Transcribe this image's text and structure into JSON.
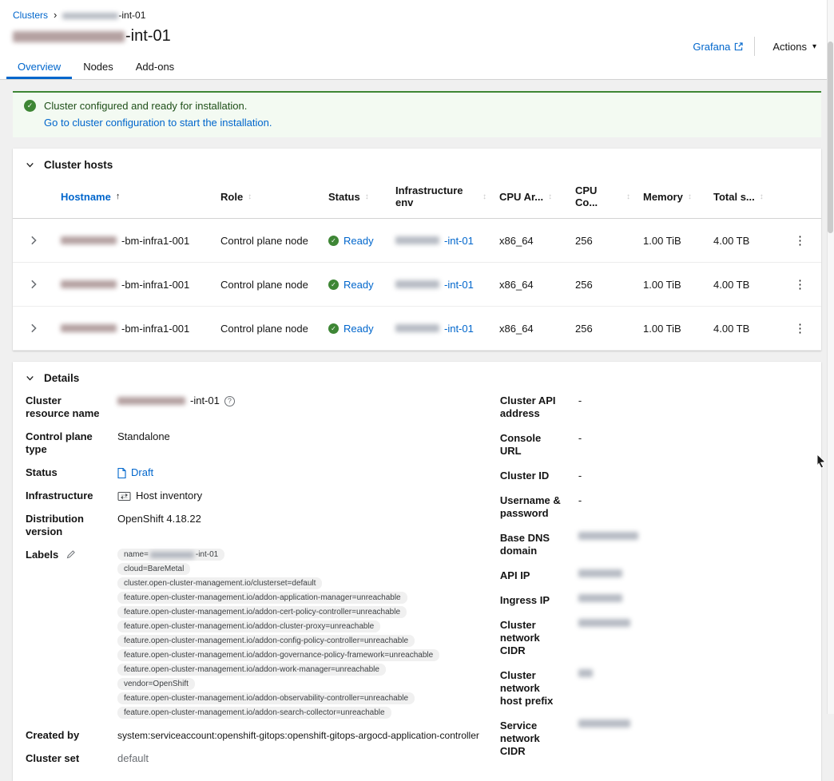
{
  "colors": {
    "accent": "#0066cc",
    "success": "#3e8635"
  },
  "icons": {
    "breadcrumb_separator": "›",
    "caret_down": "▾",
    "kebab": "⋮",
    "sort_asc": "↑",
    "sort_none": "↕",
    "check": "✓",
    "help": "?"
  },
  "breadcrumb": {
    "root": "Clusters",
    "current_suffix": "-int-01"
  },
  "title_suffix": "-int-01",
  "header_actions": {
    "grafana": "Grafana",
    "actions": "Actions"
  },
  "tabs": [
    {
      "label": "Overview",
      "active": true
    },
    {
      "label": "Nodes",
      "active": false
    },
    {
      "label": "Add-ons",
      "active": false
    }
  ],
  "alert": {
    "title": "Cluster configured and ready for installation.",
    "link_text": "Go to cluster configuration to start the installation."
  },
  "cluster_hosts": {
    "section_title": "Cluster hosts",
    "columns": {
      "hostname": "Hostname",
      "role": "Role",
      "status": "Status",
      "infra_env": "Infrastructure env",
      "cpu_arch": "CPU Ar...",
      "cpu_cores": "CPU Co...",
      "memory": "Memory",
      "total_storage": "Total s..."
    },
    "rows": [
      {
        "hostname_suffix": "-bm-infra1-001",
        "role": "Control plane node",
        "status": "Ready",
        "infra_env_suffix": "-int-01",
        "cpu_arch": "x86_64",
        "cpu_cores": "256",
        "memory": "1.00 TiB",
        "total_storage": "4.00 TB"
      },
      {
        "hostname_suffix": "-bm-infra1-001",
        "role": "Control plane node",
        "status": "Ready",
        "infra_env_suffix": "-int-01",
        "cpu_arch": "x86_64",
        "cpu_cores": "256",
        "memory": "1.00 TiB",
        "total_storage": "4.00 TB"
      },
      {
        "hostname_suffix": "-bm-infra1-001",
        "role": "Control plane node",
        "status": "Ready",
        "infra_env_suffix": "-int-01",
        "cpu_arch": "x86_64",
        "cpu_cores": "256",
        "memory": "1.00 TiB",
        "total_storage": "4.00 TB"
      }
    ]
  },
  "details": {
    "section_title": "Details",
    "left": {
      "cluster_resource_name": {
        "label": "Cluster resource name",
        "value_suffix": "-int-01"
      },
      "control_plane_type": {
        "label": "Control plane type",
        "value": "Standalone"
      },
      "status": {
        "label": "Status",
        "value": "Draft"
      },
      "infrastructure": {
        "label": "Infrastructure",
        "value": "Host inventory"
      },
      "distribution_version": {
        "label": "Distribution version",
        "value": "OpenShift 4.18.22"
      },
      "labels": {
        "label": "Labels",
        "chips": [
          {
            "prefix": "name=",
            "suffix": "-int-01"
          },
          {
            "text": "cloud=BareMetal"
          },
          {
            "text": "cluster.open-cluster-management.io/clusterset=default"
          },
          {
            "text": "feature.open-cluster-management.io/addon-application-manager=unreachable"
          },
          {
            "text": "feature.open-cluster-management.io/addon-cert-policy-controller=unreachable"
          },
          {
            "text": "feature.open-cluster-management.io/addon-cluster-proxy=unreachable"
          },
          {
            "text": "feature.open-cluster-management.io/addon-config-policy-controller=unreachable"
          },
          {
            "text": "feature.open-cluster-management.io/addon-governance-policy-framework=unreachable"
          },
          {
            "text": "feature.open-cluster-management.io/addon-work-manager=unreachable"
          },
          {
            "text": "vendor=OpenShift"
          },
          {
            "text": "feature.open-cluster-management.io/addon-observability-controller=unreachable"
          },
          {
            "text": "feature.open-cluster-management.io/addon-search-collector=unreachable"
          }
        ]
      },
      "created_by": {
        "label": "Created by",
        "value": "system:serviceaccount:openshift-gitops:openshift-gitops-argocd-application-controller"
      },
      "cluster_set": {
        "label": "Cluster set",
        "value": "default"
      }
    },
    "right": {
      "cluster_api_address": {
        "label": "Cluster API address",
        "value": "-"
      },
      "console_url": {
        "label": "Console URL",
        "value": "-"
      },
      "cluster_id": {
        "label": "Cluster ID",
        "value": "-"
      },
      "username_password": {
        "label": "Username & password",
        "value": "-"
      },
      "base_dns_domain": {
        "label": "Base DNS domain"
      },
      "api_ip": {
        "label": "API IP"
      },
      "ingress_ip": {
        "label": "Ingress IP"
      },
      "cluster_network_cidr": {
        "label": "Cluster network CIDR"
      },
      "cluster_network_host_prefix": {
        "label": "Cluster network host prefix"
      },
      "service_network_cidr": {
        "label": "Service network CIDR"
      }
    }
  }
}
